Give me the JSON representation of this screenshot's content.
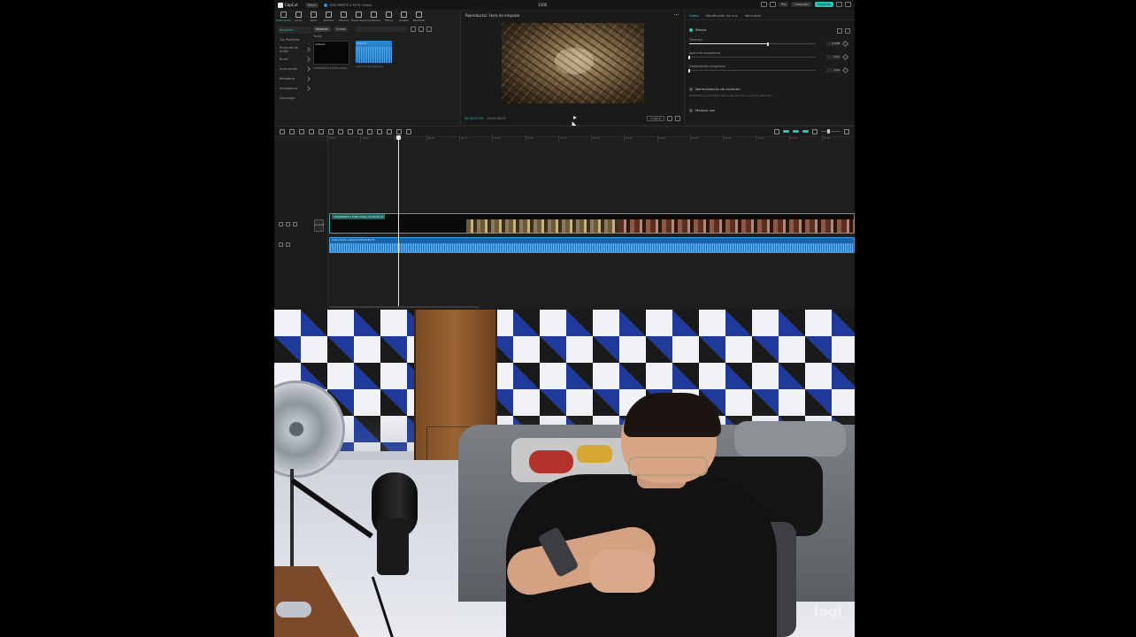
{
  "editor": {
    "app_name": "CapCut",
    "menu_label": "Menú",
    "project_name": "SUSCRIBETE A ESTE CANAL",
    "window_title": "1500",
    "top_right": {
      "btn1": "Pro",
      "btn2": "Compartir",
      "export": "Exportar"
    },
    "toolbar": [
      {
        "label": "Multimedia",
        "active": true
      },
      {
        "label": "Audio"
      },
      {
        "label": "Texto"
      },
      {
        "label": "Stickers"
      },
      {
        "label": "Efectos"
      },
      {
        "label": "Transiciones"
      },
      {
        "label": "Subtítulos"
      },
      {
        "label": "Filtros"
      },
      {
        "label": "Ajustes"
      },
      {
        "label": "Plantillas"
      }
    ],
    "left_nav": [
      {
        "label": "Importar",
        "active": true
      },
      {
        "label": "Tus Plantillas"
      },
      {
        "label": "Proyecto de Audio"
      },
      {
        "label": "Bucle"
      },
      {
        "label": "Suscripción"
      },
      {
        "label": "Biblioteca"
      },
      {
        "label": "Inteligencia"
      },
      {
        "label": "Descargar"
      }
    ],
    "media": {
      "filter_all": "Importar",
      "filter_second": "Grabar",
      "section_label": "Todos",
      "clips": [
        {
          "name": "SUSCRIBETE A ESTE CANAL",
          "badge": "Añadido",
          "kind": "video"
        },
        {
          "name": "audio-fondo-caja.mp3",
          "badge": "Añadido",
          "kind": "audio"
        }
      ]
    },
    "preview": {
      "title": "Reproductor: Hora de empezar",
      "timecode_now": "00:00:07:15",
      "timecode_total": "00:09:40:03",
      "ratio_chip": "Original",
      "full_chip": "Pantalla"
    },
    "props": {
      "tabs": [
        "Vídeo",
        "Modificador de voz",
        "Velocidad"
      ],
      "active_tab": "Vídeo",
      "section_basic": "Básico",
      "rows": [
        {
          "label": "Volumen",
          "value": "0.0dB",
          "fill": 0.62
        },
        {
          "label": "Aparición progresiva",
          "value": "0.0s",
          "fill": 0.0
        },
        {
          "label": "Desaparición progresiva",
          "value": "0.0s",
          "fill": 0.0
        }
      ],
      "section_normalize": "Normalización de volumen",
      "normalize_desc": "Normaliza el volumen original de este clip a un nivel estándar.",
      "section_voice": "Mejorar voz"
    },
    "timeline": {
      "ruler_ticks": [
        "00:00",
        "00:05",
        "00:10",
        "00:15",
        "00:20",
        "00:25",
        "00:30",
        "00:35",
        "00:40",
        "00:45",
        "00:50",
        "00:55",
        "01:00",
        "01:05",
        "01:10",
        "01:15"
      ],
      "video_clip_label": "SUSCRIBETE A ESTE CANAL 00:09:40:03",
      "audio_clip_label": "audio-fondo-caja.mp3 00:09:40:03",
      "cover_label": "Portada"
    }
  },
  "webcam": {
    "watermark": "logi"
  },
  "colors": {
    "accent": "#27c7b8",
    "audio": "#1665a8",
    "editor_bg": "#1e1e1e"
  }
}
